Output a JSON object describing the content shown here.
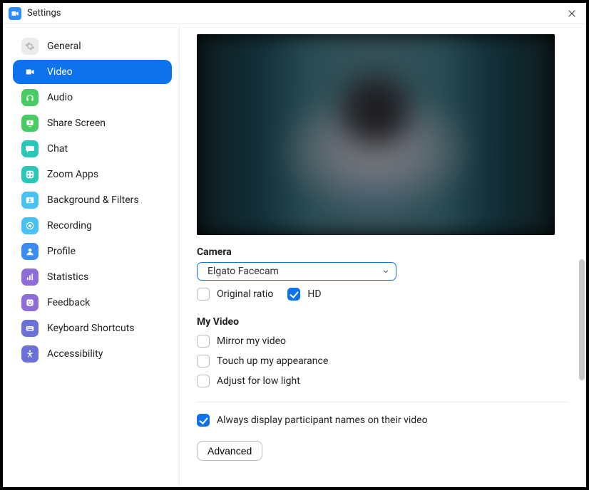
{
  "window": {
    "title": "Settings"
  },
  "accent": "#0E72ED",
  "sidebar": {
    "items": [
      {
        "id": "general",
        "label": "General",
        "icon": "gear-icon",
        "bg": "#ECECEC",
        "fg": "#BBBBBB"
      },
      {
        "id": "video",
        "label": "Video",
        "icon": "video-icon",
        "bg": "transparent",
        "fg": "#FFFFFF",
        "active": true
      },
      {
        "id": "audio",
        "label": "Audio",
        "icon": "headphones-icon",
        "bg": "#49CB64",
        "fg": "#FFFFFF"
      },
      {
        "id": "share",
        "label": "Share Screen",
        "icon": "share-icon",
        "bg": "#49CB64",
        "fg": "#FFFFFF"
      },
      {
        "id": "chat",
        "label": "Chat",
        "icon": "chat-icon",
        "bg": "#2AC6BA",
        "fg": "#FFFFFF"
      },
      {
        "id": "apps",
        "label": "Zoom Apps",
        "icon": "apps-icon",
        "bg": "#2AC6BA",
        "fg": "#FFFFFF"
      },
      {
        "id": "bgfilters",
        "label": "Background & Filters",
        "icon": "background-icon",
        "bg": "#48C2F5",
        "fg": "#FFFFFF"
      },
      {
        "id": "recording",
        "label": "Recording",
        "icon": "record-icon",
        "bg": "#48C2F5",
        "fg": "#FFFFFF"
      },
      {
        "id": "profile",
        "label": "Profile",
        "icon": "profile-icon",
        "bg": "#3B8CF0",
        "fg": "#FFFFFF"
      },
      {
        "id": "stats",
        "label": "Statistics",
        "icon": "stats-icon",
        "bg": "#8E6DD8",
        "fg": "#FFFFFF"
      },
      {
        "id": "feedback",
        "label": "Feedback",
        "icon": "feedback-icon",
        "bg": "#8E6DD8",
        "fg": "#FFFFFF"
      },
      {
        "id": "shortcuts",
        "label": "Keyboard Shortcuts",
        "icon": "keyboard-icon",
        "bg": "#6B6FD8",
        "fg": "#FFFFFF"
      },
      {
        "id": "a11y",
        "label": "Accessibility",
        "icon": "accessibility-icon",
        "bg": "#6B6FD8",
        "fg": "#FFFFFF"
      }
    ]
  },
  "video": {
    "camera_section": "Camera",
    "camera_selected": "Elgato Facecam",
    "original_ratio": {
      "label": "Original ratio",
      "checked": false
    },
    "hd": {
      "label": "HD",
      "checked": true
    },
    "my_video_section": "My Video",
    "mirror": {
      "label": "Mirror my video",
      "checked": false
    },
    "touchup": {
      "label": "Touch up my appearance",
      "checked": false
    },
    "lowlight": {
      "label": "Adjust for low light",
      "checked": false
    },
    "display_names": {
      "label": "Always display participant names on their video",
      "checked": true
    },
    "advanced_label": "Advanced"
  }
}
